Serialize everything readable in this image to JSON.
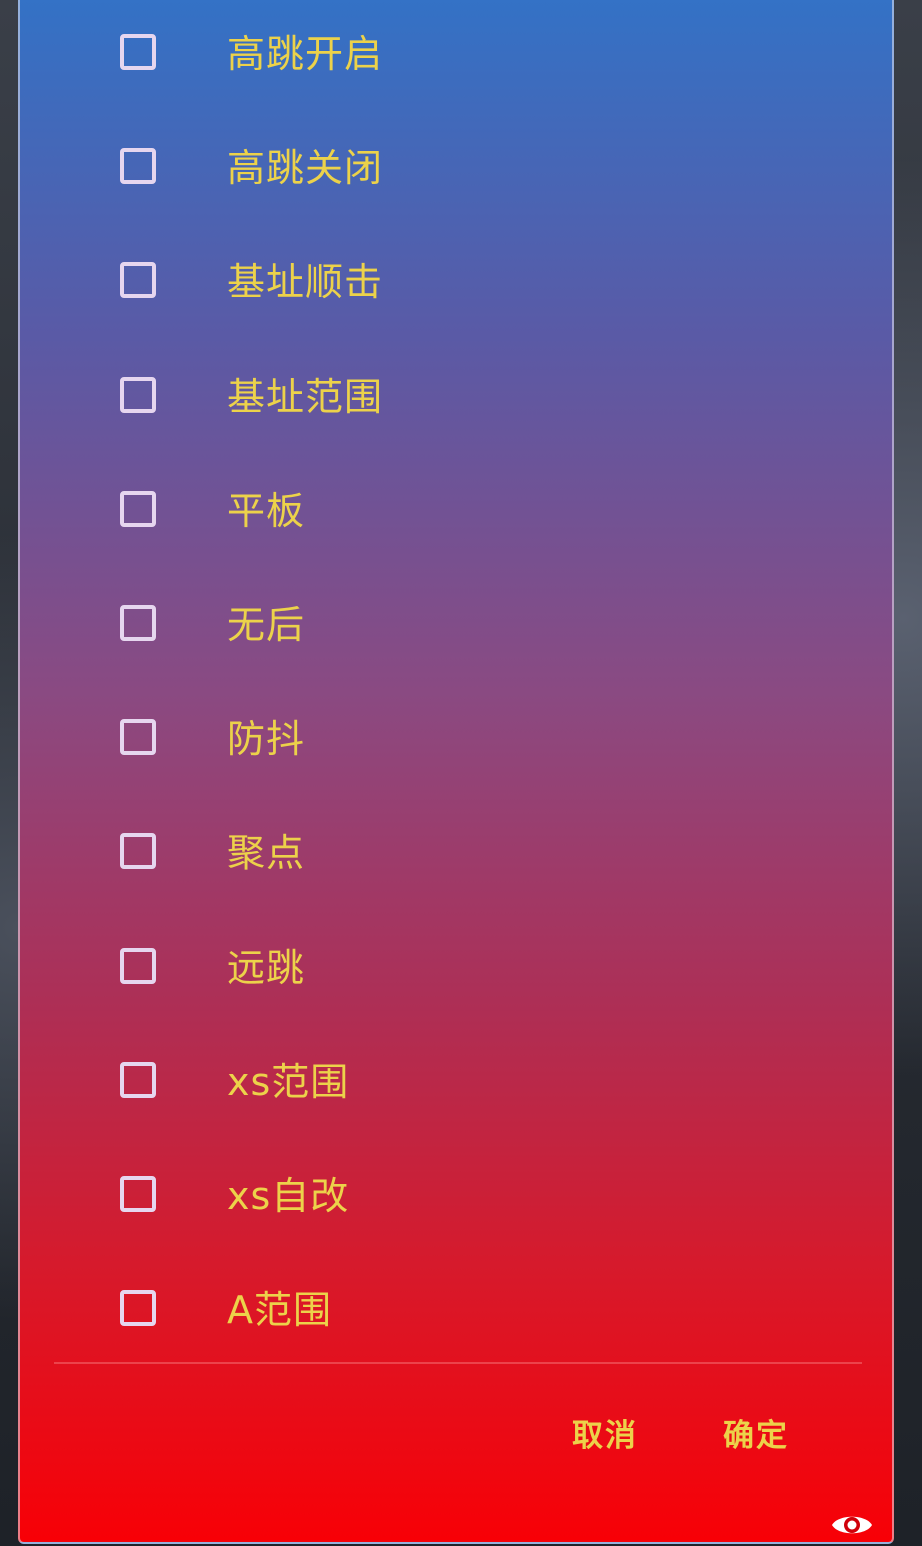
{
  "options": [
    {
      "label": "高跳开启",
      "checked": false
    },
    {
      "label": "高跳关闭",
      "checked": false
    },
    {
      "label": "基址顺击",
      "checked": false
    },
    {
      "label": "基址范围",
      "checked": false
    },
    {
      "label": "平板",
      "checked": false
    },
    {
      "label": "无后",
      "checked": false
    },
    {
      "label": "防抖",
      "checked": false
    },
    {
      "label": "聚点",
      "checked": false
    },
    {
      "label": "远跳",
      "checked": false
    },
    {
      "label": "xs范围",
      "checked": false
    },
    {
      "label": "xs自改",
      "checked": false
    },
    {
      "label": "A范围",
      "checked": false
    }
  ],
  "buttons": {
    "cancel_label": "取消",
    "confirm_label": "确定"
  },
  "icons": {
    "floating": "eye-icon"
  },
  "colors": {
    "label_text": "#ecd24a",
    "checkbox_border": "#e6d6ef",
    "gradient_top": "#3372c6",
    "gradient_bottom": "#f80006"
  }
}
